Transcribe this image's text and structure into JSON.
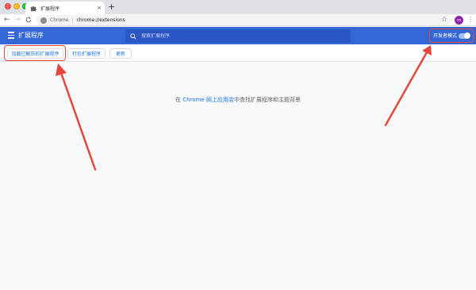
{
  "browser": {
    "tab_title": "扩展程序",
    "tab_close": "×",
    "new_tab": "+",
    "back": "←",
    "forward": "→",
    "reload": "C",
    "omnibox_chrome": "Chrome",
    "omnibox_sep": "|",
    "omnibox_url": "chrome://extensions",
    "star": "☆",
    "profile_initial": "m",
    "menu": "⋮"
  },
  "header": {
    "title": "扩展程序",
    "search_placeholder": "搜索扩展程序",
    "devmode_label": "开发者模式",
    "devmode_on": true
  },
  "actions": {
    "load_unpacked": "加载已解压的扩展程序",
    "pack": "打包扩展程序",
    "update": "更新"
  },
  "main": {
    "empty_prefix": "在 ",
    "empty_link": "Chrome 网上应用店",
    "empty_suffix": "中查找扩展程序和主题背景"
  },
  "colors": {
    "header_blue": "#3367d6",
    "link_blue": "#1a73e8",
    "annotation_red": "#e8453c"
  }
}
